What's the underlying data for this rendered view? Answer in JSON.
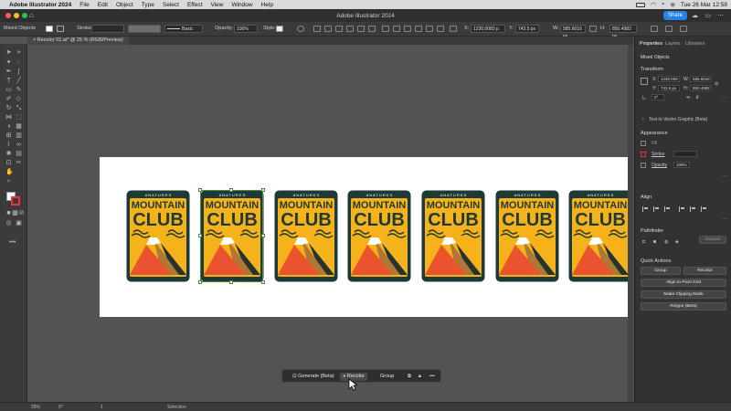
{
  "menubar": {
    "app_name": "Adobe Illustrator 2024",
    "items": [
      "File",
      "Edit",
      "Object",
      "Type",
      "Select",
      "Effect",
      "View",
      "Window",
      "Help"
    ],
    "clock": "Tue 26 Mar  12:58"
  },
  "titlebar": {
    "title": "Adobe Illustrator 2024",
    "share_label": "Share"
  },
  "controlbar": {
    "selection_type": "Mixed Objects",
    "stroke_label": "Stroke:",
    "brush_label": "Basic",
    "opacity_label": "Opacity:",
    "opacity_value": "100%",
    "style_label": "Style:",
    "x_value": "1230.0083 p",
    "y_value": "743.5 px",
    "w_value": "585.6016 px",
    "h_value": "850.4982 px"
  },
  "document_tab": {
    "label": "Recolor 01.ai* @ 25 % (RGB/Preview)"
  },
  "badge": {
    "top_text": "A N A T U R E S",
    "word1": "MOUNTAIN",
    "word2": "CLUB",
    "colors": {
      "frame": "#1e3a37",
      "yellow": "#f5b21b",
      "orange": "#e9532d",
      "brown": "#b07636",
      "dark": "#23332f",
      "snow": "#ffffff"
    }
  },
  "context_bar": {
    "generate_label": "Generate (Beta)",
    "recolor_label": "Recolor",
    "group_label": "Group",
    "more_label": "•••"
  },
  "statusbar": {
    "zoom": "25%",
    "rotation": "0°",
    "artboard_num": "1",
    "tool": "Selection"
  },
  "panel": {
    "tabs": [
      "Properties",
      "Layers",
      "Libraries"
    ],
    "selection": "Mixed Objects",
    "transform_title": "Transform",
    "x_label": "X:",
    "x_value": "1230.006",
    "w_label": "W:",
    "w_value": "585.6016",
    "y_label": "Y:",
    "y_value": "743.5 px",
    "h_label": "H:",
    "h_value": "850.4982",
    "angle_value": "0°",
    "text_to_vector": "Text to Vector Graphic (Beta)",
    "appearance_title": "Appearance",
    "fill_label": "Fill",
    "stroke_label": "Stroke",
    "opacity_label": "Opacity",
    "opacity_value": "100%",
    "align_title": "Align",
    "pathfinder_title": "Pathfinder",
    "expand_label": "Expand",
    "quick_actions_title": "Quick Actions",
    "group_btn": "Group",
    "recolor_btn": "Recolor",
    "align_pixel_btn": "Align to Pixel Grid",
    "clipping_btn": "Make Clipping Mask",
    "retype_btn": "Retype (Beta)"
  }
}
